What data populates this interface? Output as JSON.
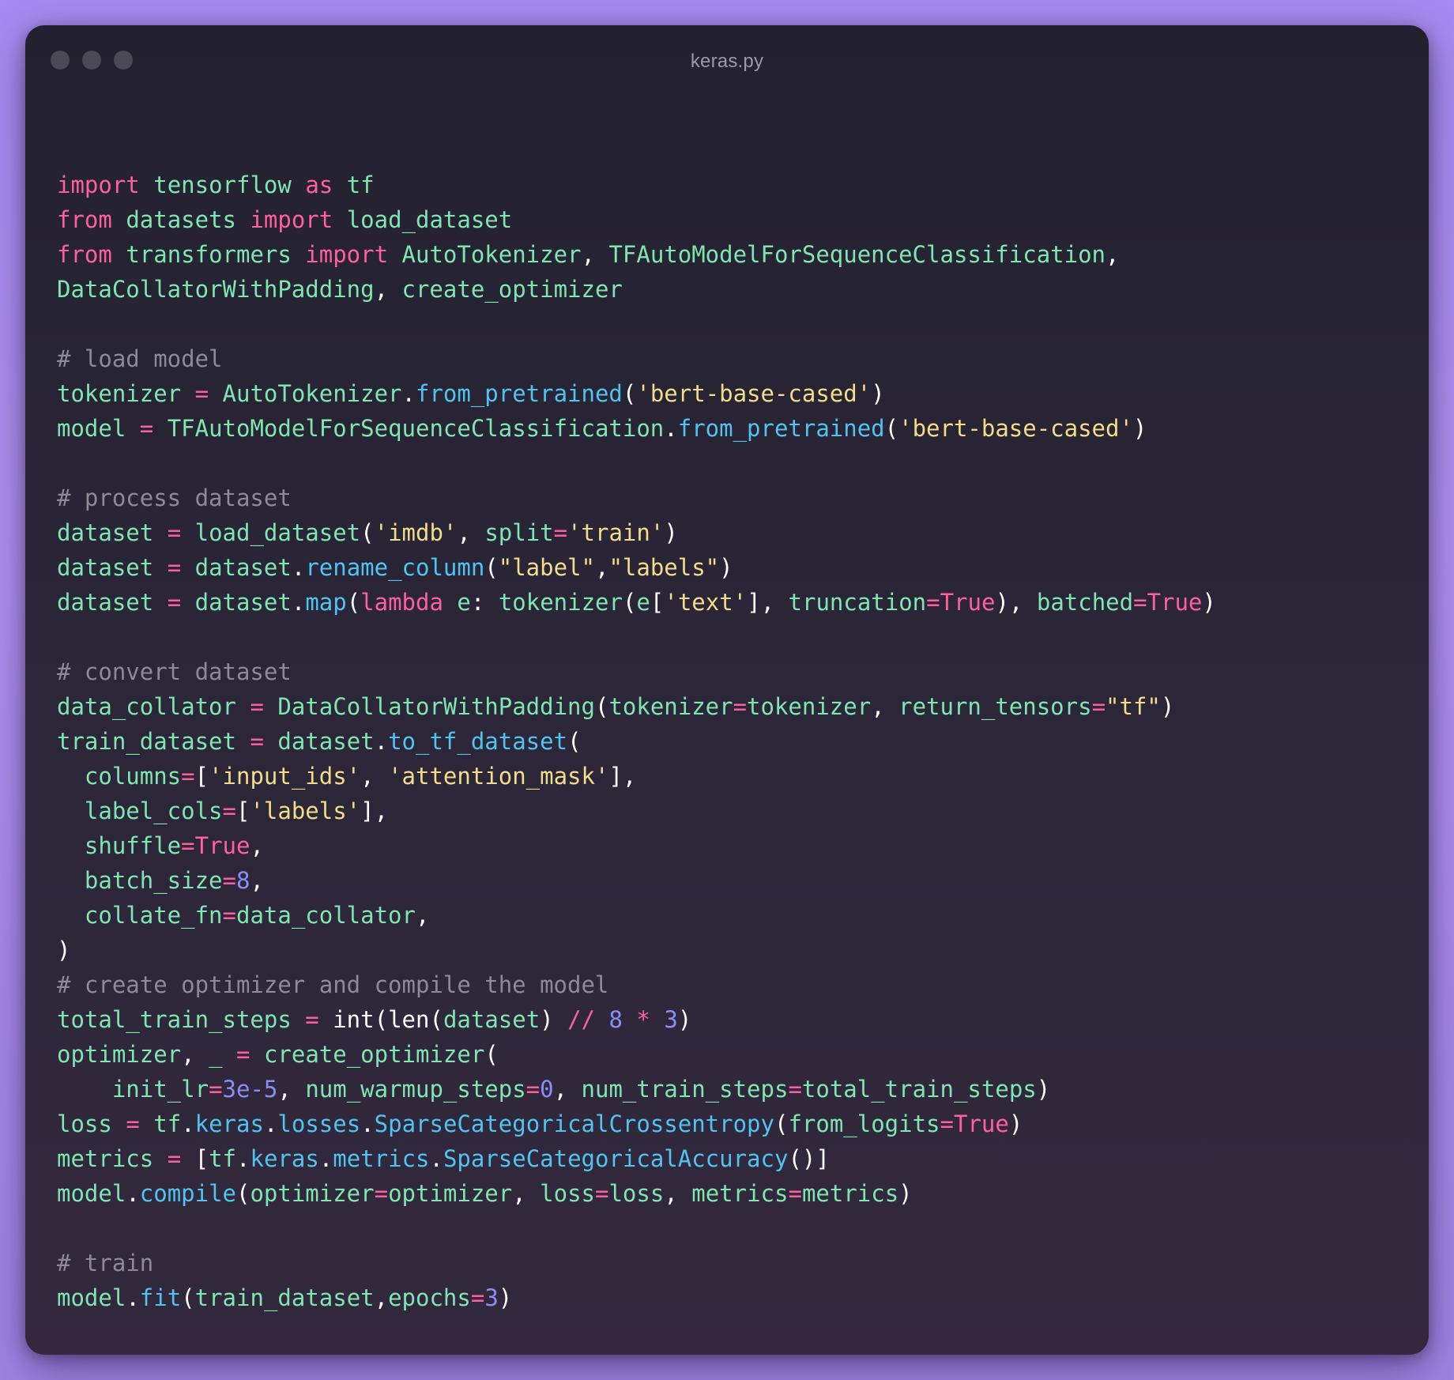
{
  "window": {
    "title": "keras.py"
  },
  "colors": {
    "keyword": "#ff5f9e",
    "identifier": "#7ee6b0",
    "function": "#4fc4f0",
    "string": "#f2dd8a",
    "number": "#8c8cf7",
    "comment": "#8d8a98",
    "punctuation": "#ffffff"
  },
  "code_lines": [
    [
      [
        "keyword",
        "import"
      ],
      [
        "plain",
        " "
      ],
      [
        "ident",
        "tensorflow"
      ],
      [
        "plain",
        " "
      ],
      [
        "keyword",
        "as"
      ],
      [
        "plain",
        " "
      ],
      [
        "ident",
        "tf"
      ]
    ],
    [
      [
        "keyword",
        "from"
      ],
      [
        "plain",
        " "
      ],
      [
        "ident",
        "datasets"
      ],
      [
        "plain",
        " "
      ],
      [
        "keyword",
        "import"
      ],
      [
        "plain",
        " "
      ],
      [
        "ident",
        "load_dataset"
      ]
    ],
    [
      [
        "keyword",
        "from"
      ],
      [
        "plain",
        " "
      ],
      [
        "ident",
        "transformers"
      ],
      [
        "plain",
        " "
      ],
      [
        "keyword",
        "import"
      ],
      [
        "plain",
        " "
      ],
      [
        "class",
        "AutoTokenizer"
      ],
      [
        "punct",
        ","
      ],
      [
        "plain",
        " "
      ],
      [
        "class",
        "TFAutoModelForSequenceClassification"
      ],
      [
        "punct",
        ","
      ]
    ],
    [
      [
        "class",
        "DataCollatorWithPadding"
      ],
      [
        "punct",
        ","
      ],
      [
        "plain",
        " "
      ],
      [
        "ident",
        "create_optimizer"
      ]
    ],
    [],
    [
      [
        "comment",
        "# load model"
      ]
    ],
    [
      [
        "ident",
        "tokenizer"
      ],
      [
        "plain",
        " "
      ],
      [
        "op",
        "="
      ],
      [
        "plain",
        " "
      ],
      [
        "class",
        "AutoTokenizer"
      ],
      [
        "punct",
        "."
      ],
      [
        "func",
        "from_pretrained"
      ],
      [
        "punct",
        "("
      ],
      [
        "string",
        "'bert-base-cased'"
      ],
      [
        "punct",
        ")"
      ]
    ],
    [
      [
        "ident",
        "model"
      ],
      [
        "plain",
        " "
      ],
      [
        "op",
        "="
      ],
      [
        "plain",
        " "
      ],
      [
        "class",
        "TFAutoModelForSequenceClassification"
      ],
      [
        "punct",
        "."
      ],
      [
        "func",
        "from_pretrained"
      ],
      [
        "punct",
        "("
      ],
      [
        "string",
        "'bert-base-cased'"
      ],
      [
        "punct",
        ")"
      ]
    ],
    [],
    [
      [
        "comment",
        "# process dataset"
      ]
    ],
    [
      [
        "ident",
        "dataset"
      ],
      [
        "plain",
        " "
      ],
      [
        "op",
        "="
      ],
      [
        "plain",
        " "
      ],
      [
        "ident",
        "load_dataset"
      ],
      [
        "punct",
        "("
      ],
      [
        "string",
        "'imdb'"
      ],
      [
        "punct",
        ","
      ],
      [
        "plain",
        " "
      ],
      [
        "param",
        "split"
      ],
      [
        "op",
        "="
      ],
      [
        "string",
        "'train'"
      ],
      [
        "punct",
        ")"
      ]
    ],
    [
      [
        "ident",
        "dataset"
      ],
      [
        "plain",
        " "
      ],
      [
        "op",
        "="
      ],
      [
        "plain",
        " "
      ],
      [
        "ident",
        "dataset"
      ],
      [
        "punct",
        "."
      ],
      [
        "func",
        "rename_column"
      ],
      [
        "punct",
        "("
      ],
      [
        "string",
        "\"label\""
      ],
      [
        "punct",
        ","
      ],
      [
        "string",
        "\"labels\""
      ],
      [
        "punct",
        ")"
      ]
    ],
    [
      [
        "ident",
        "dataset"
      ],
      [
        "plain",
        " "
      ],
      [
        "op",
        "="
      ],
      [
        "plain",
        " "
      ],
      [
        "ident",
        "dataset"
      ],
      [
        "punct",
        "."
      ],
      [
        "func",
        "map"
      ],
      [
        "punct",
        "("
      ],
      [
        "keyword",
        "lambda"
      ],
      [
        "plain",
        " "
      ],
      [
        "ident",
        "e"
      ],
      [
        "punct",
        ":"
      ],
      [
        "plain",
        " "
      ],
      [
        "ident",
        "tokenizer"
      ],
      [
        "punct",
        "("
      ],
      [
        "ident",
        "e"
      ],
      [
        "punct",
        "["
      ],
      [
        "string",
        "'text'"
      ],
      [
        "punct",
        "]"
      ],
      [
        "punct",
        ","
      ],
      [
        "plain",
        " "
      ],
      [
        "param",
        "truncation"
      ],
      [
        "op",
        "="
      ],
      [
        "const",
        "True"
      ],
      [
        "punct",
        ")"
      ],
      [
        "punct",
        ","
      ],
      [
        "plain",
        " "
      ],
      [
        "param",
        "batched"
      ],
      [
        "op",
        "="
      ],
      [
        "const",
        "True"
      ],
      [
        "punct",
        ")"
      ]
    ],
    [],
    [
      [
        "comment",
        "# convert dataset"
      ]
    ],
    [
      [
        "ident",
        "data_collator"
      ],
      [
        "plain",
        " "
      ],
      [
        "op",
        "="
      ],
      [
        "plain",
        " "
      ],
      [
        "class",
        "DataCollatorWithPadding"
      ],
      [
        "punct",
        "("
      ],
      [
        "param",
        "tokenizer"
      ],
      [
        "op",
        "="
      ],
      [
        "ident",
        "tokenizer"
      ],
      [
        "punct",
        ","
      ],
      [
        "plain",
        " "
      ],
      [
        "param",
        "return_tensors"
      ],
      [
        "op",
        "="
      ],
      [
        "string",
        "\"tf\""
      ],
      [
        "punct",
        ")"
      ]
    ],
    [
      [
        "ident",
        "train_dataset"
      ],
      [
        "plain",
        " "
      ],
      [
        "op",
        "="
      ],
      [
        "plain",
        " "
      ],
      [
        "ident",
        "dataset"
      ],
      [
        "punct",
        "."
      ],
      [
        "func",
        "to_tf_dataset"
      ],
      [
        "punct",
        "("
      ]
    ],
    [
      [
        "plain",
        "  "
      ],
      [
        "param",
        "columns"
      ],
      [
        "op",
        "="
      ],
      [
        "punct",
        "["
      ],
      [
        "string",
        "'input_ids'"
      ],
      [
        "punct",
        ","
      ],
      [
        "plain",
        " "
      ],
      [
        "string",
        "'attention_mask'"
      ],
      [
        "punct",
        "]"
      ],
      [
        "punct",
        ","
      ]
    ],
    [
      [
        "plain",
        "  "
      ],
      [
        "param",
        "label_cols"
      ],
      [
        "op",
        "="
      ],
      [
        "punct",
        "["
      ],
      [
        "string",
        "'labels'"
      ],
      [
        "punct",
        "]"
      ],
      [
        "punct",
        ","
      ]
    ],
    [
      [
        "plain",
        "  "
      ],
      [
        "param",
        "shuffle"
      ],
      [
        "op",
        "="
      ],
      [
        "const",
        "True"
      ],
      [
        "punct",
        ","
      ]
    ],
    [
      [
        "plain",
        "  "
      ],
      [
        "param",
        "batch_size"
      ],
      [
        "op",
        "="
      ],
      [
        "number",
        "8"
      ],
      [
        "punct",
        ","
      ]
    ],
    [
      [
        "plain",
        "  "
      ],
      [
        "param",
        "collate_fn"
      ],
      [
        "op",
        "="
      ],
      [
        "ident",
        "data_collator"
      ],
      [
        "punct",
        ","
      ]
    ],
    [
      [
        "punct",
        ")"
      ]
    ],
    [
      [
        "comment",
        "# create optimizer and compile the model"
      ]
    ],
    [
      [
        "ident",
        "total_train_steps"
      ],
      [
        "plain",
        " "
      ],
      [
        "op",
        "="
      ],
      [
        "plain",
        " "
      ],
      [
        "builtin",
        "int"
      ],
      [
        "punct",
        "("
      ],
      [
        "builtin",
        "len"
      ],
      [
        "punct",
        "("
      ],
      [
        "ident",
        "dataset"
      ],
      [
        "punct",
        ")"
      ],
      [
        "plain",
        " "
      ],
      [
        "op",
        "//"
      ],
      [
        "plain",
        " "
      ],
      [
        "number",
        "8"
      ],
      [
        "plain",
        " "
      ],
      [
        "op",
        "*"
      ],
      [
        "plain",
        " "
      ],
      [
        "number",
        "3"
      ],
      [
        "punct",
        ")"
      ]
    ],
    [
      [
        "ident",
        "optimizer"
      ],
      [
        "punct",
        ","
      ],
      [
        "plain",
        " "
      ],
      [
        "ident",
        "_"
      ],
      [
        "plain",
        " "
      ],
      [
        "op",
        "="
      ],
      [
        "plain",
        " "
      ],
      [
        "ident",
        "create_optimizer"
      ],
      [
        "punct",
        "("
      ]
    ],
    [
      [
        "plain",
        "    "
      ],
      [
        "param",
        "init_lr"
      ],
      [
        "op",
        "="
      ],
      [
        "number",
        "3e-5"
      ],
      [
        "punct",
        ","
      ],
      [
        "plain",
        " "
      ],
      [
        "param",
        "num_warmup_steps"
      ],
      [
        "op",
        "="
      ],
      [
        "number",
        "0"
      ],
      [
        "punct",
        ","
      ],
      [
        "plain",
        " "
      ],
      [
        "param",
        "num_train_steps"
      ],
      [
        "op",
        "="
      ],
      [
        "ident",
        "total_train_steps"
      ],
      [
        "punct",
        ")"
      ]
    ],
    [
      [
        "ident",
        "loss"
      ],
      [
        "plain",
        " "
      ],
      [
        "op",
        "="
      ],
      [
        "plain",
        " "
      ],
      [
        "ident",
        "tf"
      ],
      [
        "punct",
        "."
      ],
      [
        "func",
        "keras"
      ],
      [
        "punct",
        "."
      ],
      [
        "func",
        "losses"
      ],
      [
        "punct",
        "."
      ],
      [
        "func",
        "SparseCategoricalCrossentropy"
      ],
      [
        "punct",
        "("
      ],
      [
        "param",
        "from_logits"
      ],
      [
        "op",
        "="
      ],
      [
        "const",
        "True"
      ],
      [
        "punct",
        ")"
      ]
    ],
    [
      [
        "ident",
        "metrics"
      ],
      [
        "plain",
        " "
      ],
      [
        "op",
        "="
      ],
      [
        "plain",
        " "
      ],
      [
        "punct",
        "["
      ],
      [
        "ident",
        "tf"
      ],
      [
        "punct",
        "."
      ],
      [
        "func",
        "keras"
      ],
      [
        "punct",
        "."
      ],
      [
        "func",
        "metrics"
      ],
      [
        "punct",
        "."
      ],
      [
        "func",
        "SparseCategoricalAccuracy"
      ],
      [
        "punct",
        "()"
      ],
      [
        "punct",
        "]"
      ]
    ],
    [
      [
        "ident",
        "model"
      ],
      [
        "punct",
        "."
      ],
      [
        "func",
        "compile"
      ],
      [
        "punct",
        "("
      ],
      [
        "param",
        "optimizer"
      ],
      [
        "op",
        "="
      ],
      [
        "ident",
        "optimizer"
      ],
      [
        "punct",
        ","
      ],
      [
        "plain",
        " "
      ],
      [
        "param",
        "loss"
      ],
      [
        "op",
        "="
      ],
      [
        "ident",
        "loss"
      ],
      [
        "punct",
        ","
      ],
      [
        "plain",
        " "
      ],
      [
        "param",
        "metrics"
      ],
      [
        "op",
        "="
      ],
      [
        "ident",
        "metrics"
      ],
      [
        "punct",
        ")"
      ]
    ],
    [],
    [
      [
        "comment",
        "# train"
      ]
    ],
    [
      [
        "ident",
        "model"
      ],
      [
        "punct",
        "."
      ],
      [
        "func",
        "fit"
      ],
      [
        "punct",
        "("
      ],
      [
        "ident",
        "train_dataset"
      ],
      [
        "punct",
        ","
      ],
      [
        "param",
        "epochs"
      ],
      [
        "op",
        "="
      ],
      [
        "number",
        "3"
      ],
      [
        "punct",
        ")"
      ]
    ]
  ]
}
